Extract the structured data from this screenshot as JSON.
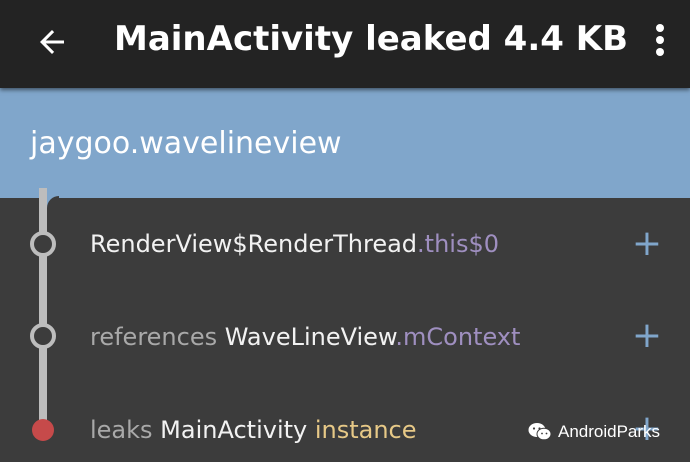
{
  "appbar": {
    "title": "MainActivity leaked 4.4 KB",
    "back_icon": "arrow-back-icon",
    "overflow_icon": "more-vert-icon"
  },
  "header": {
    "package": "jaygoo.wavelineview"
  },
  "trace": [
    {
      "parts": [
        "RenderView$RenderThread",
        ".this$0"
      ],
      "expand_label": "+"
    },
    {
      "parts": [
        "references ",
        "WaveLineView",
        ".mContext"
      ],
      "expand_label": "+"
    },
    {
      "parts": [
        "leaks ",
        "MainActivity",
        " instance"
      ],
      "expand_label": "+"
    }
  ],
  "watermark": {
    "text": "AndroidParks",
    "icon": "wechat-icon"
  },
  "colors": {
    "appbar": "#232323",
    "header": "#80a6cb",
    "background": "#3c3c3c",
    "leak_node": "#c64a4a",
    "field": "#9f8fc0",
    "instance": "#e7c987"
  }
}
